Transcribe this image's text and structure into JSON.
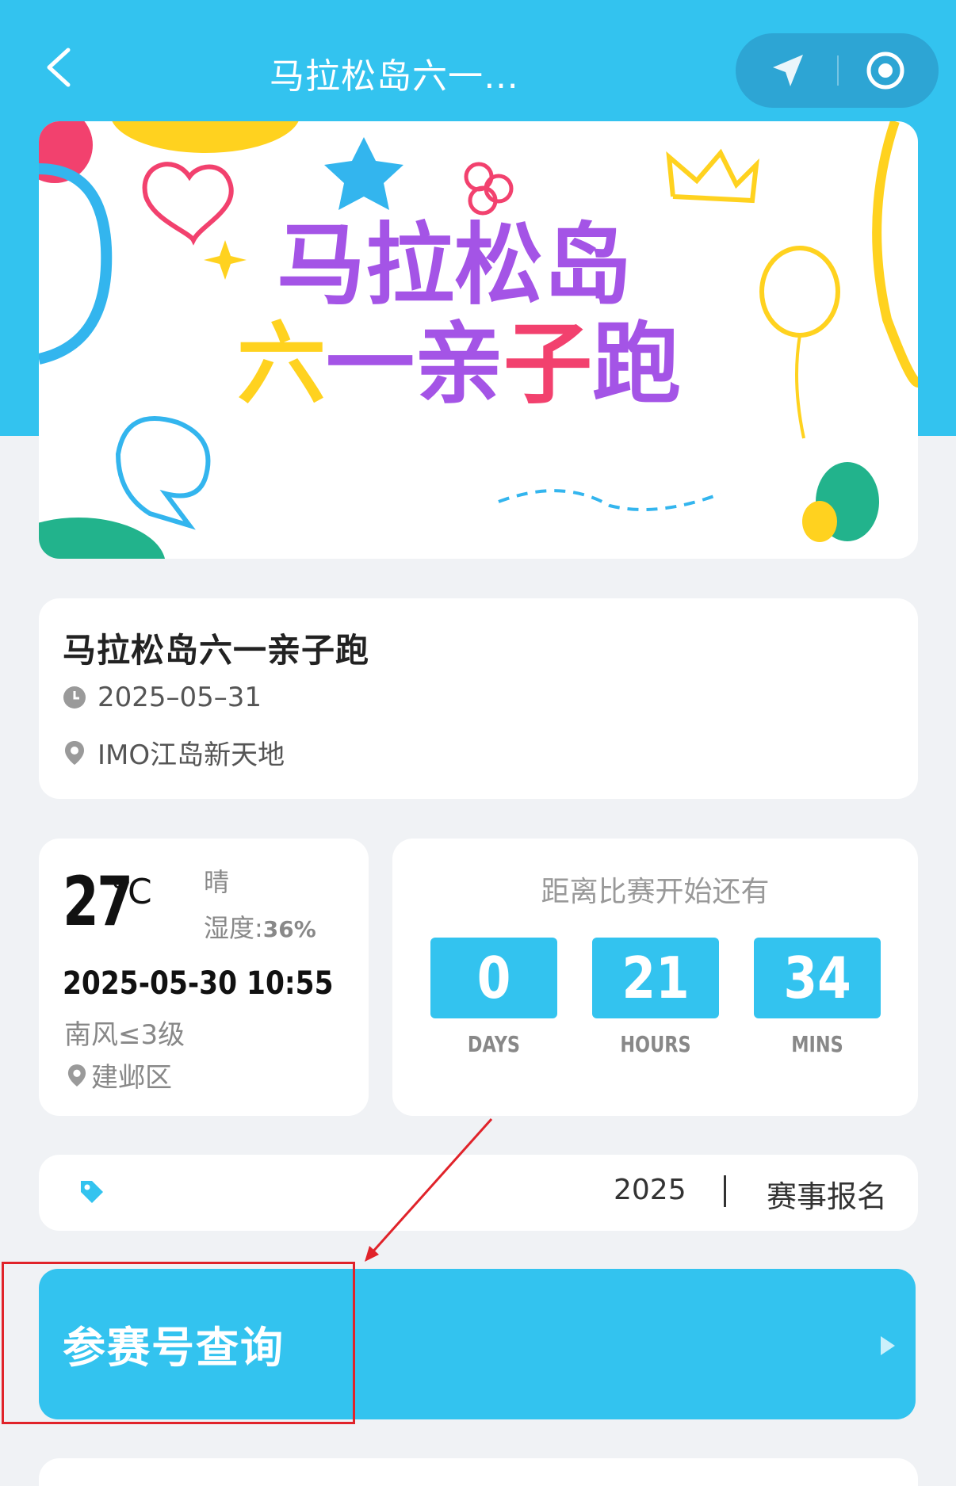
{
  "header": {
    "title": "马拉松岛六一…",
    "back_icon": "chevron-left-icon",
    "location_icon": "navigation-arrow-icon",
    "target_icon": "record-circle-icon"
  },
  "banner": {
    "line1": "马拉松岛",
    "line2": "六一亲子跑"
  },
  "event": {
    "name": "马拉松岛六一亲子跑",
    "date": "2025–05–31",
    "location": "IMO江岛新天地"
  },
  "weather": {
    "temp": "27",
    "unit": "°C",
    "condition": "晴",
    "humidity_label": "湿度:",
    "humidity_value": "36%",
    "datetime": "2025-05-30 10:55",
    "wind": "南风≤3级",
    "district": "建邺区"
  },
  "countdown": {
    "title": "距离比赛开始还有",
    "days": "0",
    "days_label": "DAYS",
    "hours": "21",
    "hours_label": "HOURS",
    "mins": "34",
    "mins_label": "MINS"
  },
  "registration": {
    "year": "2025",
    "link": "赛事报名"
  },
  "query": {
    "label": "参赛号查询"
  },
  "colors": {
    "primary": "#33c3ef",
    "annotation": "#e0232a",
    "background": "#f0f2f5"
  }
}
